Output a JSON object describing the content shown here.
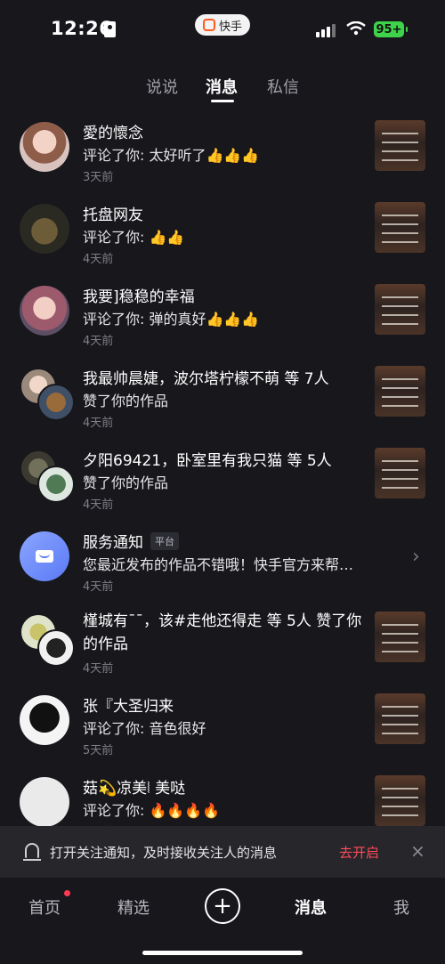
{
  "status_bar": {
    "time": "12:26",
    "app_pill": "快手",
    "battery": "95+"
  },
  "tabs": [
    {
      "label": "说说",
      "active": false
    },
    {
      "label": "消息",
      "active": true
    },
    {
      "label": "私信",
      "active": false
    }
  ],
  "messages": [
    {
      "name": "愛的懷念",
      "text": "评论了你: 太好听了👍👍👍",
      "time": "3天前"
    },
    {
      "name": "托盘网友",
      "text": "评论了你: 👍👍",
      "time": "4天前"
    },
    {
      "name": "我要]稳稳的幸福",
      "text": "评论了你: 弹的真好👍👍👍",
      "time": "4天前"
    },
    {
      "name": "我最帅晨婕，波尔塔柠檬不萌 等 7人",
      "text": "赞了你的作品",
      "time": "4天前"
    },
    {
      "name": "夕阳69421，卧室里有我只猫 等 5人",
      "text": "赞了你的作品",
      "time": "4天前"
    },
    {
      "name": "服务通知",
      "badge": "平台",
      "text": "您最近发布的作品不错哦！快手官方来帮…",
      "time": "4天前"
    },
    {
      "name": "槿城有¯¯，该#走他还得走 等 5人 赞了你的作品",
      "time": "4天前"
    },
    {
      "name": "张『大圣归来",
      "text": "评论了你: 音色很好",
      "time": "5天前"
    },
    {
      "name": "菇💫凉美⦚ 美哒",
      "text": "评论了你: 🔥🔥🔥🔥",
      "time": "5天前"
    }
  ],
  "notification_bar": {
    "text": "打开关注通知，及时接收关注人的消息",
    "action": "去开启",
    "close": "×"
  },
  "bottom_nav": {
    "home": "首页",
    "featured": "精选",
    "plus": "+",
    "messages": "消息",
    "me": "我"
  }
}
